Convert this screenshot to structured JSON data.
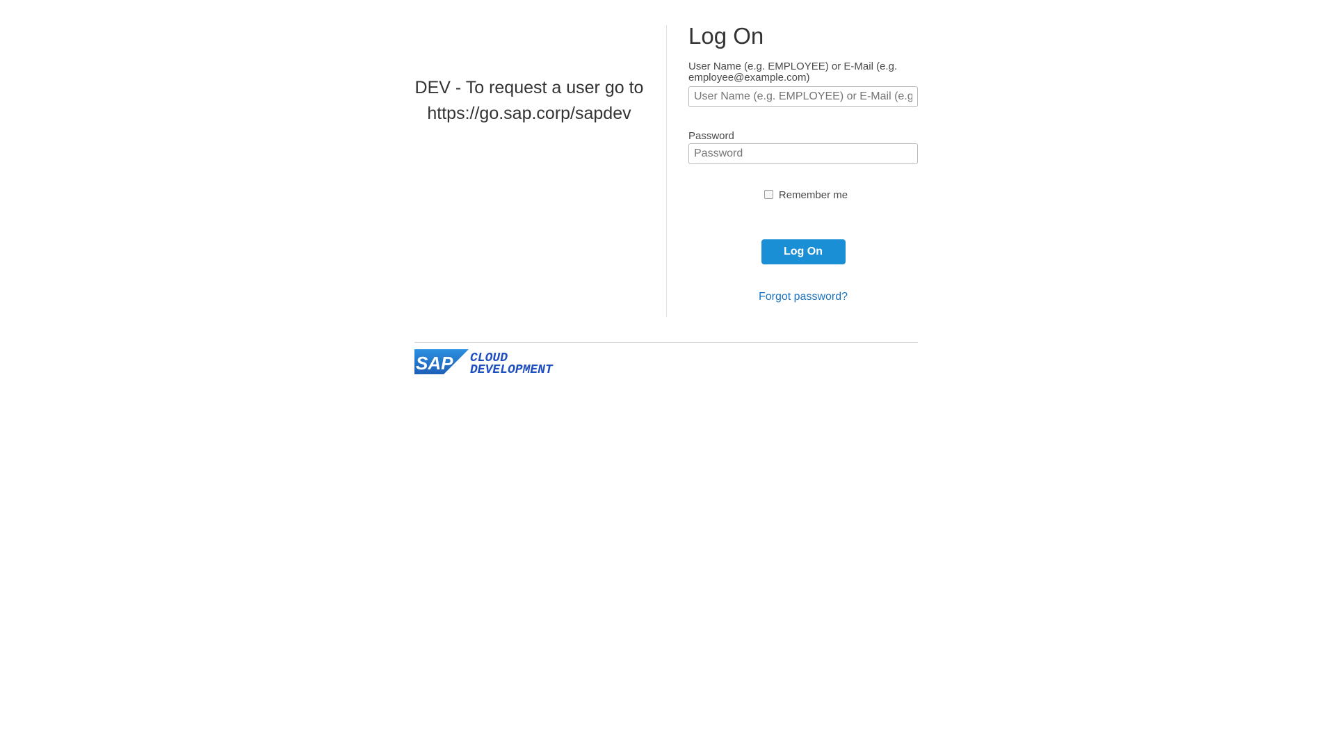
{
  "info": {
    "line1": "DEV - To request a user go to",
    "line2": "https://go.sap.corp/sapdev"
  },
  "login": {
    "title": "Log On",
    "username_label": "User Name (e.g. EMPLOYEE) or E-Mail (e.g. employee@example.com)",
    "username_placeholder": "User Name (e.g. EMPLOYEE) or E-Mail (e.g. employee@example.com)",
    "username_value": "",
    "password_label": "Password",
    "password_placeholder": "Password",
    "password_value": "",
    "remember_label": "Remember me",
    "remember_checked": false,
    "submit_label": "Log On",
    "forgot_label": "Forgot password?"
  },
  "footer": {
    "logo_brand": "SAP",
    "logo_line1": "CLOUD",
    "logo_line2": "DEVELOPMENT"
  },
  "colors": {
    "primary_button": "#1b8fd6",
    "link": "#1a74c0",
    "logo_blue": "#1f4fbf"
  },
  "icons": {
    "checkbox": "checkbox-unchecked"
  }
}
